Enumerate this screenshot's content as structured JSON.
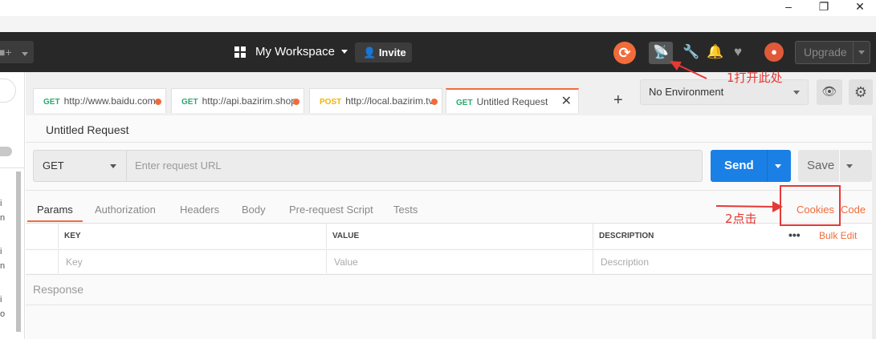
{
  "window": {
    "minimize": "–",
    "restore": "❐",
    "close": "✕"
  },
  "header": {
    "new_icon": "plus-icon",
    "workspace": "My Workspace",
    "invite": "Invite",
    "upgrade": "Upgrade",
    "icons": [
      "sync-icon",
      "interceptor-icon",
      "wrench-icon",
      "bell-icon",
      "heart-icon",
      "avatar"
    ]
  },
  "sidebar": {
    "fragments": [
      "i",
      "n",
      "i",
      "n",
      "i",
      "o"
    ]
  },
  "tabs": [
    {
      "method": "GET",
      "url": "http://www.baidu.com",
      "method_color": "#2ca870",
      "unsaved": true
    },
    {
      "method": "GET",
      "url": "http://api.bazirim.shop",
      "method_color": "#2ca870",
      "unsaved": true
    },
    {
      "method": "POST",
      "url": "http://local.bazirim.tv",
      "method_color": "#f4b400",
      "unsaved": true
    },
    {
      "method": "GET",
      "url": "Untitled Request",
      "method_color": "#2ca870",
      "active": true
    }
  ],
  "environment": {
    "selected": "No Environment"
  },
  "request": {
    "name": "Untitled Request",
    "method": "GET",
    "url_placeholder": "Enter request URL",
    "send": "Send",
    "save": "Save"
  },
  "subtabs": [
    "Params",
    "Authorization",
    "Headers",
    "Body",
    "Pre-request Script",
    "Tests"
  ],
  "links": {
    "cookies": "Cookies",
    "code": "Code"
  },
  "params_table": {
    "headers": [
      "KEY",
      "VALUE",
      "DESCRIPTION"
    ],
    "placeholders": [
      "Key",
      "Value",
      "Description"
    ],
    "more": "•••",
    "bulk_edit": "Bulk Edit"
  },
  "response": {
    "label": "Response"
  },
  "annotations": {
    "step1": "1打开此处",
    "step2": "2点击"
  },
  "colors": {
    "accent": "#f26b3a",
    "send": "#1a80e5",
    "annotation": "#e53935",
    "header_bg": "#282828"
  }
}
